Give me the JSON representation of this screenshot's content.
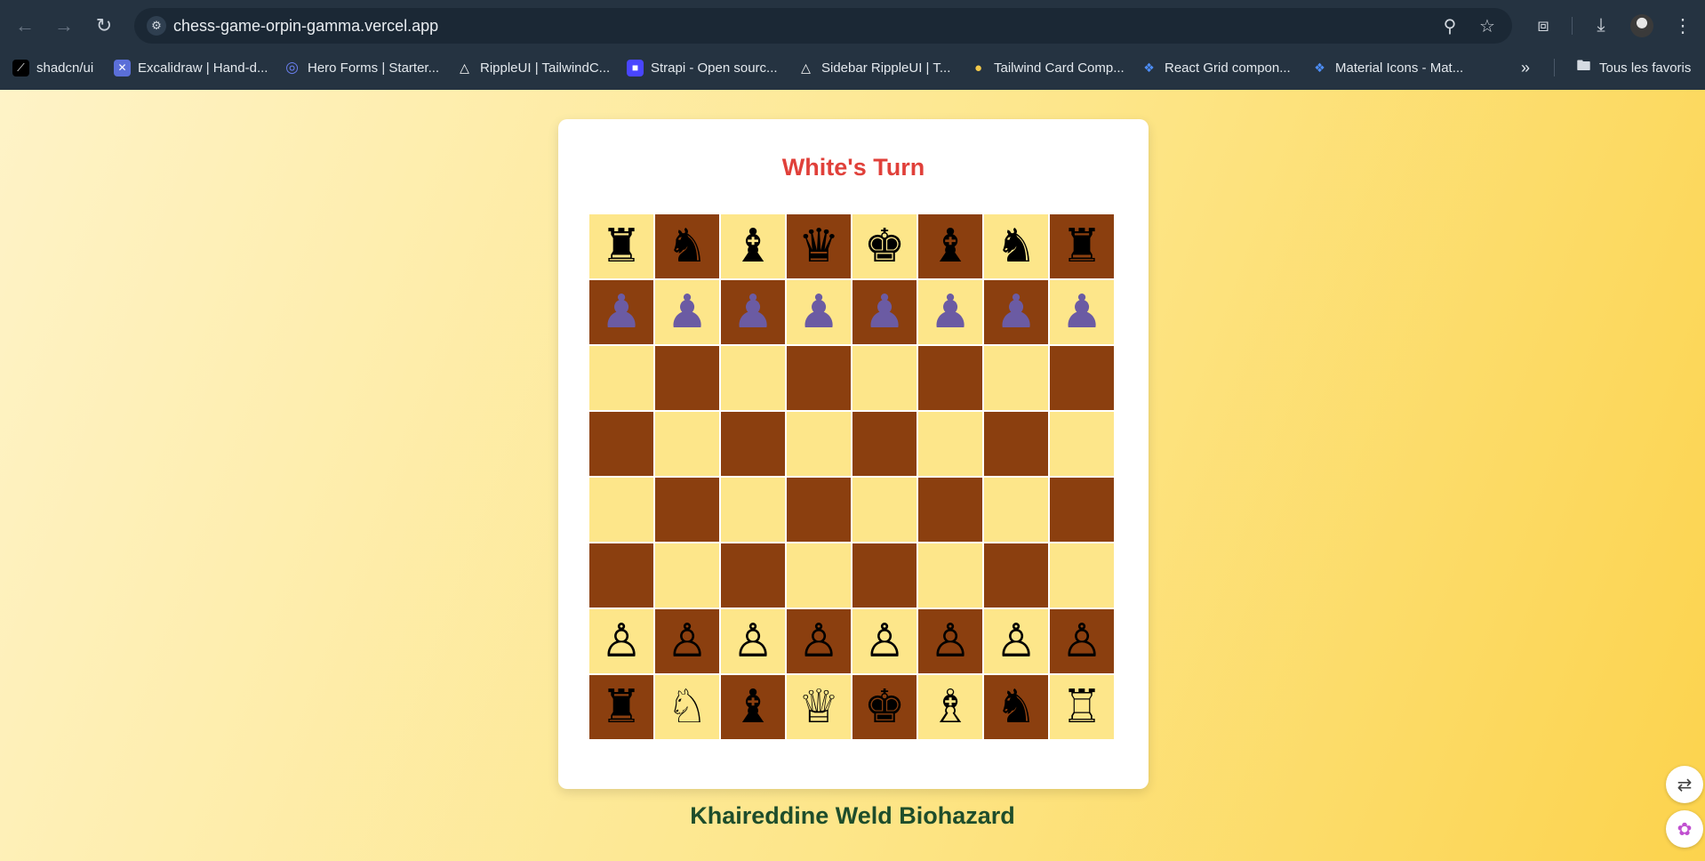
{
  "browser": {
    "url": "chess-game-orpin-gamma.vercel.app",
    "bookmarks": [
      {
        "label": "shadcn/ui",
        "icon": "shadcn-icon"
      },
      {
        "label": "Excalidraw | Hand-d...",
        "icon": "excalidraw-icon"
      },
      {
        "label": "Hero Forms | Starter...",
        "icon": "hero-forms-icon"
      },
      {
        "label": "RippleUI | TailwindC...",
        "icon": "rippleui-icon"
      },
      {
        "label": "Strapi - Open sourc...",
        "icon": "strapi-icon"
      },
      {
        "label": "Sidebar RippleUI | T...",
        "icon": "rippleui-icon"
      },
      {
        "label": "Tailwind Card Comp...",
        "icon": "tailwind-card-icon"
      },
      {
        "label": "React Grid compon...",
        "icon": "mui-icon"
      },
      {
        "label": "Material Icons - Mat...",
        "icon": "mui-icon"
      }
    ],
    "all_bookmarks_label": "Tous les favoris",
    "overflow_glyph": "»"
  },
  "game": {
    "turn_text": "White's Turn",
    "author": "Khaireddine Weld Biohazard",
    "colors": {
      "light_square": "#fde68a",
      "dark_square": "#8b3f0f",
      "turn_text": "#e0403a",
      "author_text": "#1e4d2b",
      "black_pawn": "#6b5ba3"
    },
    "board": [
      [
        "♜",
        "♞",
        "♝",
        "♛",
        "♚",
        "♝",
        "♞",
        "♜"
      ],
      [
        "♟",
        "♟",
        "♟",
        "♟",
        "♟",
        "♟",
        "♟",
        "♟"
      ],
      [
        "",
        "",
        "",
        "",
        "",
        "",
        "",
        ""
      ],
      [
        "",
        "",
        "",
        "",
        "",
        "",
        "",
        ""
      ],
      [
        "",
        "",
        "",
        "",
        "",
        "",
        "",
        ""
      ],
      [
        "",
        "",
        "",
        "",
        "",
        "",
        "",
        ""
      ],
      [
        "♙",
        "♙",
        "♙",
        "♙",
        "♙",
        "♙",
        "♙",
        "♙"
      ],
      [
        "♜",
        "♘",
        "♝",
        "♕",
        "♚",
        "♗",
        "♞",
        "♖"
      ]
    ]
  }
}
